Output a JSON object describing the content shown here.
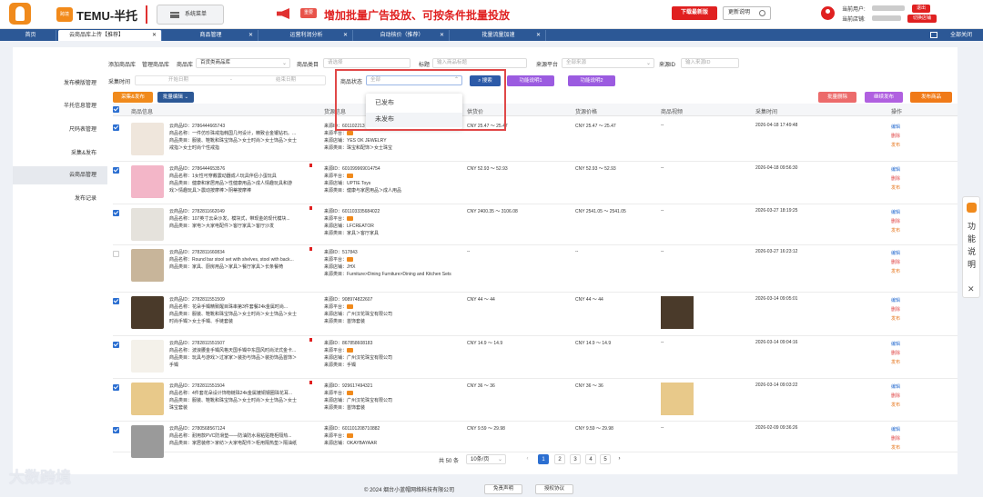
{
  "topbar": {
    "brand": "TEMU-半托",
    "logo_text": "跨境",
    "system_menu": "系统菜单",
    "hot_badge": "重要",
    "banner": "增加批量广告投放、可按条件批量投放",
    "download_btn": "下载最新版",
    "update_btn": "更新说明",
    "user_label": "当前用户:",
    "store_label": "当前店铺:",
    "logout": "退出",
    "switch_store": "切换店铺"
  },
  "tabs": [
    {
      "label": "首页",
      "active": false
    },
    {
      "label": "云商品库上传【推荐】",
      "active": true
    },
    {
      "label": "商品管理",
      "active": false
    },
    {
      "label": "运营利润分析",
      "active": false
    },
    {
      "label": "自动核价（推荐）",
      "active": false
    },
    {
      "label": "批量流量加速",
      "active": false
    }
  ],
  "close_all": "全部关闭",
  "sidebar": [
    {
      "label": "发布模版管理",
      "active": false
    },
    {
      "label": "半托信息管理",
      "active": false
    },
    {
      "label": "尺码表管理",
      "active": false
    },
    {
      "label": "采集&发布",
      "active": false
    },
    {
      "label": "云商品管理",
      "active": true
    },
    {
      "label": "发布记录",
      "active": false
    }
  ],
  "filters": {
    "add_product": "添加商品库",
    "manage_product": "管理商品库",
    "library_label": "商品库",
    "library_value": "百货类商品库",
    "category_label": "商品类目",
    "category_ph": "请选择",
    "title_label": "标题",
    "title_ph": "输入商品标题",
    "platform_label": "来源平台",
    "platform_ph": "全部来源",
    "source_id_label": "来源ID",
    "source_id_ph": "输入来源ID",
    "collect_time_label": "采集时间",
    "start_ph": "开始日期",
    "dash": "-",
    "end_ph": "结束日期",
    "status_label": "商品状态",
    "status_ph": "全部",
    "search_btn": "搜索",
    "help1": "功能说明1",
    "help2": "功能说明2"
  },
  "status_options": [
    "已发布",
    "未发布"
  ],
  "actions": {
    "collect_publish": "采集&发布",
    "batch_edit": "批量编辑",
    "batch_delete": "批量删除",
    "continue_publish": "继续发布",
    "publish_product": "发布商品"
  },
  "columns": [
    "商品信息",
    "货源信息",
    "供货价",
    "货源价格",
    "商品视频",
    "采集时间",
    "操作"
  ],
  "rows": [
    {
      "checked": true,
      "flag": false,
      "thumb_color": "#efe6dc",
      "cloud_id": "云商品ID：2786444665743",
      "name": "商品名称：一件仿珍珠戒指韩国几何设计，精致合金镶钻石。...",
      "cat1": "商品类目：服装、鞋靴和珠宝饰品＞女士时尚＞女士饰品＞女士",
      "cat2": "戒指＞女士时尚个性戒指",
      "src_id": "来源ID：601102213",
      "platform": "来源平台：",
      "store": "来源店铺：YES OK JEWELRY",
      "src_cat": "来源类目：珠宝和配饰＞女士珠宝",
      "supply": "CNY 25.47 ～ 25.47",
      "price": "CNY 25.47 ～ 25.47",
      "video": "--",
      "video_thumb": false,
      "time": "2026-04-18 17:49:48"
    },
    {
      "checked": true,
      "flag": true,
      "thumb_color": "#f3b6c8",
      "cloud_id": "云商品ID：2786444653576",
      "name": "商品名称：1女性可穿戴震动器成人玩具伴侣小蛋玩具",
      "cat1": "商品类目：健康和家居用品＞性健康用品＞成人情趣玩具和游",
      "cat2": "戏＞情趣玩具＞震动按摩棒＞阴蒂按摩棒",
      "src_id": "来源ID：601099969014754",
      "platform": "来源平台：",
      "store": "来源店铺：UPTIE Toys",
      "src_cat": "来源类目：健康与家居用品＞成人用品",
      "supply": "CNY 52.93 ～ 52.93",
      "price": "CNY 52.93 ～ 52.93",
      "video": "--",
      "video_thumb": false,
      "time": "2026-04-18 09:56:30"
    },
    {
      "checked": true,
      "flag": true,
      "thumb_color": "#e5e2dc",
      "cloud_id": "云商品ID：2782811662049",
      "name": "商品名称：107英寸云朵沙发，模块式，带现金的现代模块...",
      "cat1": "商品类目：家电＞大家电配件＞客厅家具＞客厅沙发",
      "cat2": "",
      "src_id": "来源ID：601103335684022",
      "platform": "来源平台：",
      "store": "来源店铺：LFCREATOR",
      "src_cat": "来源类目：家具＞客厅家具",
      "supply": "CNY 2400.35 ～ 3106.08",
      "price": "CNY 2541.05 ～ 2541.05",
      "video": "--",
      "video_thumb": false,
      "time": "2026-03-27 18:19:25"
    },
    {
      "checked": false,
      "flag": true,
      "thumb_color": "#c8b59a",
      "cloud_id": "云商品ID：2782811660834",
      "name": "商品名称：Round bar stool set with shelves, stool with back...",
      "cat1": "商品类目：家具、厨房用品＞家具＞餐厅家具＞长条餐椅",
      "cat2": "",
      "src_id": "来源ID：517843",
      "platform": "来源平台：",
      "store": "来源店铺：JHX",
      "src_cat": "来源类目：Furniture>Dining Furniture>Dining and Kitchen Sets",
      "supply": "--",
      "price": "--",
      "video": "--",
      "video_thumb": false,
      "time": "2026-03-27 16:23:12"
    },
    {
      "checked": true,
      "flag": false,
      "thumb_color": "#4a3a2a",
      "cloud_id": "云商品ID：2782811551509",
      "name": "商品名称：花朵手镯精致醒目珠串第3件套餐24k金属时尚...",
      "cat1": "商品类目：服装、鞋靴和珠宝饰品＞女士时尚＞女士饰品＞女士",
      "cat2": "时尚手镯＞女士手镯、手链套装",
      "src_id": "来源ID：908974822607",
      "platform": "来源平台：",
      "store": "来源店铺：广州汉花珠宝有限公司",
      "src_cat": "来源类目：首饰套装",
      "supply": "CNY 44 ～ 44",
      "price": "CNY 44 ～ 44",
      "video": "",
      "video_thumb": true,
      "time": "2026-03-14 09:05:01"
    },
    {
      "checked": true,
      "flag": true,
      "thumb_color": "#f4f1ea",
      "cloud_id": "云商品ID：2782811551507",
      "name": "商品名称：波浪腰金手镯风格天国手镯中东国风时尚法式金卡...",
      "cat1": "商品类目：玩具与游戏＞过家家＞装扮与饰品＞装扮饰品首饰＞",
      "cat2": "手镯",
      "src_id": "来源ID：867858608183",
      "platform": "来源平台：",
      "store": "来源店铺：广州汉花珠宝有限公司",
      "src_cat": "来源类目：手镯",
      "supply": "CNY 14.9 ～ 14.9",
      "price": "CNY 14.9 ～ 14.9",
      "video": "--",
      "video_thumb": false,
      "time": "2026-03-14 09:04:16"
    },
    {
      "checked": true,
      "flag": true,
      "thumb_color": "#e8c98a",
      "cloud_id": "云商品ID：2782811551504",
      "name": "商品名称：4件套花朵设计饰物链珠24k金属镀铜钢圈珠花耳...",
      "cat1": "商品类目：服装、鞋靴和珠宝饰品＞女士时尚＞女士饰品＞女士",
      "cat2": "珠宝套装",
      "src_id": "来源ID：929617494321",
      "platform": "来源平台：",
      "store": "来源店铺：广州汉花珠宝有限公司",
      "src_cat": "来源类目：首饰套装",
      "supply": "CNY 36 ～ 36",
      "price": "CNY 36 ～ 36",
      "video": "",
      "video_thumb": true,
      "time": "2026-03-14 09:03:22"
    },
    {
      "checked": true,
      "flag": false,
      "thumb_color": "#9a9a9a",
      "cloud_id": "云商品ID：2780568567124",
      "name": "商品名称：耐用款PVC防滑垫——防油防水易粘贴鞋柜隔热...",
      "cat1": "商品类目：家居装修＞家纺＞大家电配件＞柜用隔热垫＞隔油纸",
      "cat2": "",
      "src_id": "来源ID：601101208710882",
      "platform": "来源平台：",
      "store": "来源店铺：OKAYBAYAAR",
      "src_cat": "",
      "supply": "CNY 9.59 ～ 29.98",
      "price": "CNY 9.59 ～ 29.98",
      "video": "--",
      "video_thumb": false,
      "time": "2026-02-09 09:36:26"
    }
  ],
  "ops": {
    "edit": "编辑",
    "delete": "删除",
    "publish": "发布"
  },
  "pagination": {
    "total": "共 50 条",
    "page_size": "10条/页",
    "prev": "‹",
    "pages": [
      "1",
      "2",
      "3",
      "4",
      "5"
    ],
    "next": "›",
    "current": "1"
  },
  "footer": {
    "copyright": "© 2024 烟台小蓝帽网络科技有限公司",
    "disclaimer": "免责声明",
    "auth": "授权协议"
  },
  "watermark": "大数跨境",
  "side_panel": {
    "text": "功能说明",
    "close": "✕"
  }
}
